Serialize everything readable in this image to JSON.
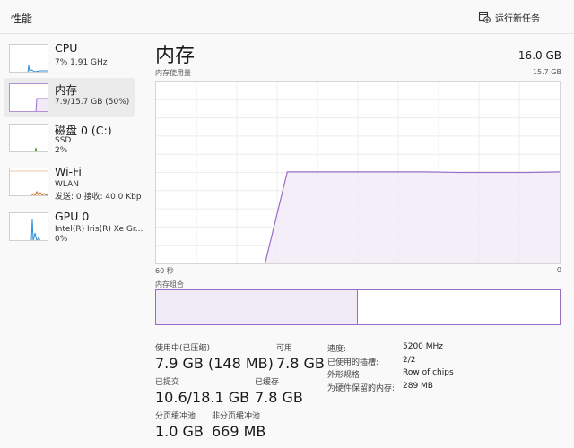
{
  "window": {
    "title": "性能"
  },
  "toolbar": {
    "run_task_label": "运行新任务",
    "run_task_icon": "run-task-icon"
  },
  "sidebar": {
    "items": [
      {
        "name": "CPU",
        "sub1": "7%  1.91 GHz",
        "sub2": ""
      },
      {
        "name": "内存",
        "sub1": "7.9/15.7 GB (50%)",
        "sub2": ""
      },
      {
        "name": "磁盘 0 (C:)",
        "sub1": "SSD",
        "sub2": "2%"
      },
      {
        "name": "Wi-Fi",
        "sub1": "WLAN",
        "sub2": "发送: 0 接收: 40.0 Kbp"
      },
      {
        "name": "GPU 0",
        "sub1": "Intel(R) Iris(R) Xe Gr...",
        "sub2": "0%"
      }
    ]
  },
  "main": {
    "title": "内存",
    "total": "16.0 GB",
    "usage_label": "内存使用量",
    "usage_max": "15.7 GB",
    "graph_left": "60 秒",
    "graph_right": "0",
    "composition_label": "内存组合",
    "composition_used_fraction": 0.5
  },
  "stats": {
    "in_use_label": "使用中(已压缩)",
    "in_use_value": "7.9 GB (148 MB)",
    "available_label": "可用",
    "available_value": "7.8 GB",
    "committed_label": "已提交",
    "committed_value": "10.6/18.1 GB",
    "cached_label": "已缓存",
    "cached_value": "7.8 GB",
    "paged_label": "分页缓冲池",
    "paged_value": "1.0 GB",
    "nonpaged_label": "非分页缓冲池",
    "nonpaged_value": "669 MB"
  },
  "specs": {
    "speed_label": "速度:",
    "speed_value": "5200 MHz",
    "slots_label": "已使用的插槽:",
    "slots_value": "2/2",
    "form_label": "外形规格:",
    "form_value": "Row of chips",
    "reserved_label": "为硬件保留的内存:",
    "reserved_value": "289 MB"
  },
  "colors": {
    "memory_accent": "#9b6cc6",
    "memory_fill": "#f1ebf7",
    "cpu_accent": "#2e8ed8",
    "disk_accent": "#4a9a2c",
    "wifi_accent": "#c2702a",
    "selected_bg": "#ebebeb"
  },
  "chart_data": {
    "type": "area",
    "xlabel": "60 秒",
    "ylabel": "内存使用量",
    "xlim": [
      60,
      0
    ],
    "ylim": [
      0,
      15.7
    ],
    "x": [
      60,
      44,
      43.8,
      40.5,
      35,
      30,
      25,
      20,
      15,
      10,
      5,
      0
    ],
    "series": [
      {
        "values": [
          0,
          0,
          0,
          7.9,
          7.9,
          7.9,
          7.9,
          7.9,
          7.85,
          7.85,
          7.85,
          7.9
        ]
      }
    ]
  }
}
